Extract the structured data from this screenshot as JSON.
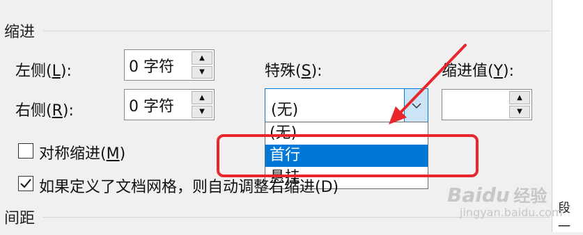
{
  "indent_section": {
    "title": "缩进"
  },
  "spacing_section": {
    "title": "间距"
  },
  "left": {
    "label_prefix": "左侧(",
    "label_key": "L",
    "label_suffix": "):",
    "value": "0 字符"
  },
  "right": {
    "label_prefix": "右侧(",
    "label_key": "R",
    "label_suffix": "):",
    "value": "0 字符"
  },
  "special": {
    "label_prefix": "特殊(",
    "label_key": "S",
    "label_suffix": "):",
    "selected": "(无)",
    "options": [
      "(无)",
      "首行",
      "悬挂"
    ],
    "highlighted_index": 1
  },
  "indent_value": {
    "label_prefix": "缩进值(",
    "label_key": "Y",
    "label_suffix": "):",
    "value": ""
  },
  "mirror_indent": {
    "label_prefix": "对称缩进(",
    "label_key": "M",
    "label_suffix": ")",
    "checked": false
  },
  "grid_auto": {
    "label": "如果定义了文档网格，则自动调整右缩进(D)",
    "checked": true
  },
  "right_panel": {
    "glyph_1": "段",
    "glyph_2": "一"
  },
  "watermark": {
    "logo": "Baidu",
    "word": "经验",
    "url": "jingyan.baidu.com"
  },
  "colors": {
    "accent": "#0078d7",
    "annotation": "#e8262c"
  }
}
